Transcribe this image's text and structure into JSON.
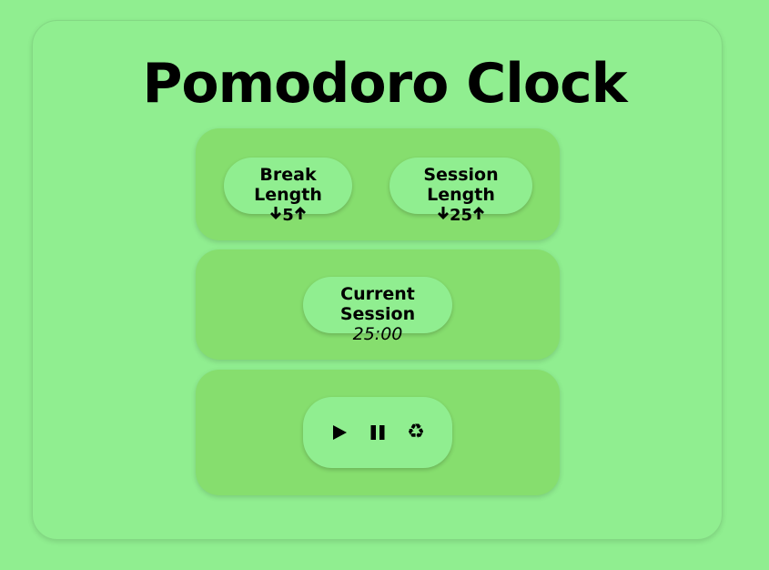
{
  "app": {
    "title": "Pomodoro Clock"
  },
  "lengths": {
    "break": {
      "label": "Break Length",
      "value": "5",
      "decrement_icon": "arrow-down-icon",
      "increment_icon": "arrow-up-icon"
    },
    "session": {
      "label": "Session Length",
      "value": "25",
      "decrement_icon": "arrow-down-icon",
      "increment_icon": "arrow-up-icon"
    }
  },
  "current": {
    "label": "Current Session",
    "time": "25:00"
  },
  "controls": {
    "play_icon": "play-icon",
    "pause_icon": "pause-icon",
    "reset_icon": "recycle-icon",
    "reset_glyph": "♻"
  },
  "colors": {
    "background": "#90ee90",
    "panel": "#86de6e",
    "text": "#000000"
  }
}
